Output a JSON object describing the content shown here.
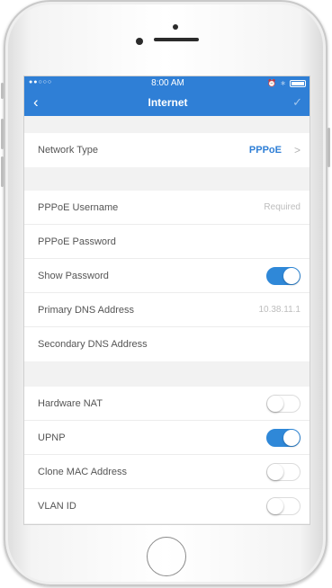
{
  "status_bar": {
    "signal": "●●○○○ ",
    "wifi_icon": "wifi-icon",
    "time": "8:00 AM",
    "alarm": "⏰",
    "bluetooth": "∗"
  },
  "nav": {
    "back": "‹",
    "title": "Internet",
    "confirm": "✓"
  },
  "network": {
    "label": "Network Type",
    "value": "PPPoE",
    "chevron": ">"
  },
  "pppoe": {
    "username_label": "PPPoE Username",
    "username_placeholder": "Required",
    "password_label": "PPPoE Password",
    "show_password_label": "Show Password",
    "show_password_on": true,
    "primary_dns_label": "Primary DNS Address",
    "primary_dns_value": "10.38.11.1",
    "secondary_dns_label": "Secondary DNS Address"
  },
  "advanced": {
    "hardware_nat_label": "Hardware NAT",
    "hardware_nat_on": false,
    "upnp_label": "UPNP",
    "upnp_on": true,
    "clone_mac_label": "Clone MAC Address",
    "clone_mac_on": false,
    "vlan_label": "VLAN ID",
    "vlan_on": false
  },
  "colors": {
    "accent": "#2f7fd6",
    "toggle_on": "#2f88d8"
  }
}
